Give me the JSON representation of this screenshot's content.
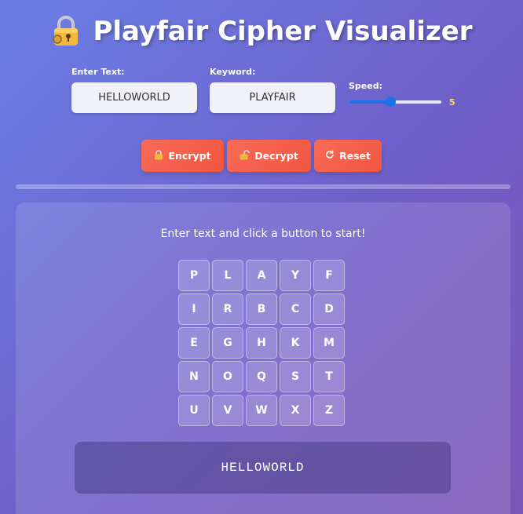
{
  "app": {
    "title": "Playfair Cipher Visualizer",
    "title_icon": "lock-with-key-icon"
  },
  "inputs": {
    "text_label": "Enter Text:",
    "text_value": "HELLOWORLD",
    "keyword_label": "Keyword:",
    "keyword_value": "PLAYFAIR",
    "speed_label": "Speed:",
    "speed_value": "5",
    "speed_fraction": 0.45
  },
  "buttons": {
    "encrypt": {
      "label": "Encrypt",
      "icon": "lock-icon"
    },
    "decrypt": {
      "label": "Decrypt",
      "icon": "unlock-icon"
    },
    "reset": {
      "label": "Reset",
      "icon": "reload-icon"
    }
  },
  "progress": {
    "fraction": 0.0
  },
  "main": {
    "status": "Enter text and click a button to start!",
    "grid": [
      [
        "P",
        "L",
        "A",
        "Y",
        "F"
      ],
      [
        "I",
        "R",
        "B",
        "C",
        "D"
      ],
      [
        "E",
        "G",
        "H",
        "K",
        "M"
      ],
      [
        "N",
        "O",
        "Q",
        "S",
        "T"
      ],
      [
        "U",
        "V",
        "W",
        "X",
        "Z"
      ]
    ],
    "output": "HELLOWORLD"
  },
  "colors": {
    "button": "#f2563f",
    "slider": "#1a73e8",
    "speed_value": "#ffd84a"
  }
}
